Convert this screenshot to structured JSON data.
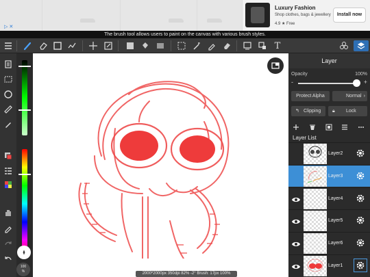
{
  "ad": {
    "title": "Luxury Fashion",
    "description": "Shop clothes, bags & jewellery",
    "rating": "4.9 ★  Free",
    "install_label": "Install now",
    "ad_badge": "▷ ✕"
  },
  "hint_text": "The brush tool allows users to paint on the canvas with various brush styles.",
  "toolbar": {
    "icons": [
      "menu-icon",
      "brush-icon",
      "eraser-icon",
      "rect-icon",
      "lasso-wand-icon",
      "move-icon",
      "transform-icon",
      "fill-color-icon",
      "bucket-icon",
      "gradient-icon",
      "selection-icon",
      "magic-wand-icon",
      "eyedropper-select-icon",
      "select-eraser-icon",
      "select-all-icon",
      "canvas-icon",
      "text-icon",
      "materials-icon",
      "layers-icon"
    ],
    "text_tool_label": "T"
  },
  "left_tools": {
    "icons": [
      "pages-icon",
      "selection-list-icon",
      "redo-circle-icon",
      "ruler-icon",
      "pen-icon",
      "color-swatch-icon",
      "palette-list-icon",
      "palette-grid-icon",
      "hand-icon",
      "eyedropper-icon",
      "redo-icon",
      "undo-icon"
    ],
    "zoom_label": "100\n%"
  },
  "sliders": {
    "brush_size_fraction": 0.0,
    "opacity_fraction": 0.6,
    "hue_fraction": 0.22
  },
  "status_text": "2000*2000px 350dpi 82% -2° Brush: 17px 100%",
  "panel": {
    "title": "Layer",
    "opacity_label": "Opacity",
    "opacity_value": "100%",
    "opacity_fraction": 1.0,
    "protect_alpha_label": "Protect Alpha",
    "blend_mode": "Normal",
    "clipping_label": "Clipping",
    "lock_label": "Lock",
    "list_label": "Layer List",
    "layers": [
      {
        "name": "Layer2",
        "visible": false,
        "selected": false
      },
      {
        "name": "Layer3",
        "visible": false,
        "selected": true
      },
      {
        "name": "Layer4",
        "visible": true,
        "selected": false
      },
      {
        "name": "Layer5",
        "visible": true,
        "selected": false
      },
      {
        "name": "Layer6",
        "visible": true,
        "selected": false
      },
      {
        "name": "Layer1",
        "visible": true,
        "selected": false
      }
    ]
  },
  "colors": {
    "accent": "#3d8fd6",
    "stroke": "#ee4b4b",
    "eye_fill": "#ee3b3b"
  }
}
